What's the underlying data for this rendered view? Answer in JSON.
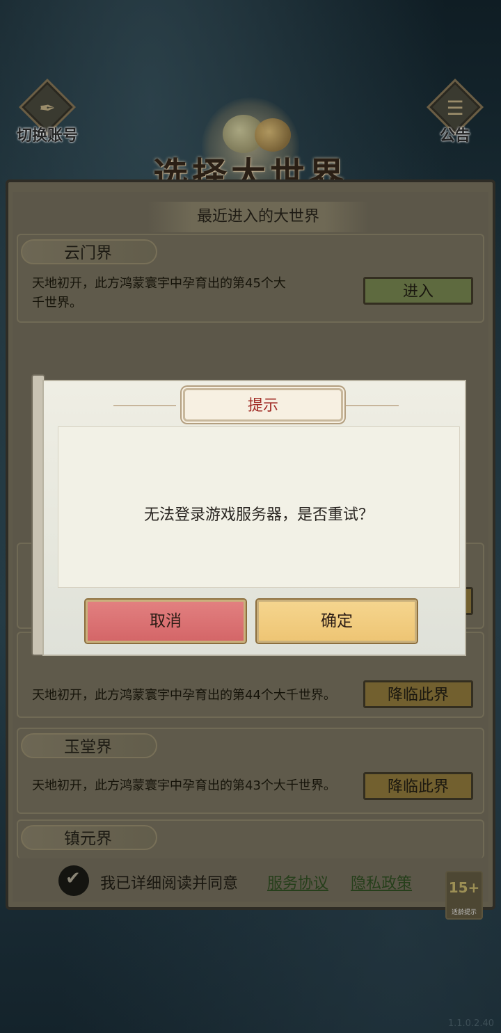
{
  "header": {
    "switch_account": "切换账号",
    "notice": "公告",
    "title": "选择大世界"
  },
  "panel": {
    "section_title": "最近进入的大世界",
    "worlds": [
      {
        "name": "云门界",
        "desc_line1": "天地初开，此方鸿蒙寰宇中孕育出的第45个大",
        "desc_line2": "千世界。",
        "button": "进入"
      },
      {
        "name": "",
        "desc": "天地初开，此方鸿蒙寰宇中孕育出的第44个大千世界。",
        "button": "降临此界"
      },
      {
        "name": "玉堂界",
        "desc": "天地初开，此方鸿蒙寰宇中孕育出的第43个大千世界。",
        "button": "降临此界"
      },
      {
        "name": "镇元界"
      }
    ]
  },
  "agreement": {
    "text": "我已详细阅读并同意",
    "service": "服务协议",
    "privacy": "隐私政策"
  },
  "age_badge": {
    "rating": "15+",
    "label": "适龄提示"
  },
  "version": "1.1.0.2.40",
  "dialog": {
    "title": "提示",
    "message": "无法登录游戏服务器，是否重试？",
    "cancel": "取消",
    "confirm": "确定"
  },
  "colors": {
    "cancel": "#d46668",
    "confirm": "#eec574",
    "title_text": "#a02a24"
  }
}
